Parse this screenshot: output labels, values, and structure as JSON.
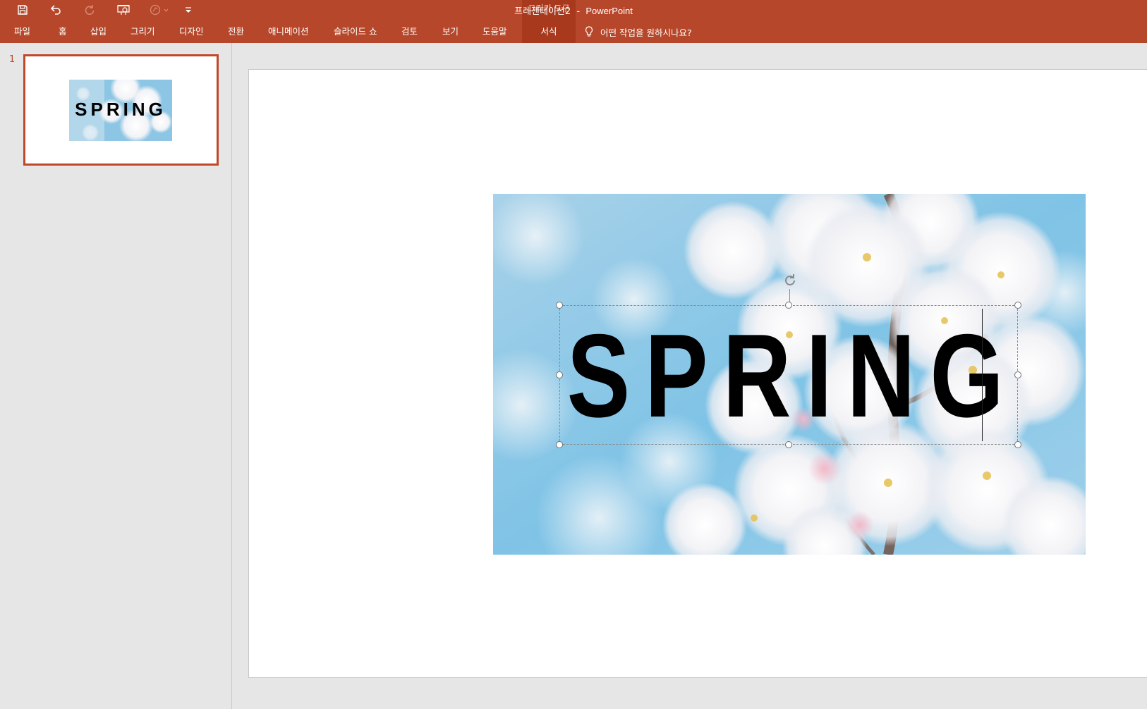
{
  "titlebar": {
    "document_title": "프레젠테이션2",
    "separator": "  -  ",
    "app_name": "PowerPoint",
    "contextual_group": "그리기 도구",
    "background_color": "#b7472a"
  },
  "quick_access": {
    "icons": [
      "save-icon",
      "undo-icon",
      "redo-icon",
      "start-slideshow-icon",
      "touch-mode-icon",
      "customize-qat-icon"
    ]
  },
  "ribbon": {
    "tabs": [
      {
        "label": "파일"
      },
      {
        "label": "홈"
      },
      {
        "label": "삽입"
      },
      {
        "label": "그리기"
      },
      {
        "label": "디자인"
      },
      {
        "label": "전환"
      },
      {
        "label": "애니메이션"
      },
      {
        "label": "슬라이드 쇼"
      },
      {
        "label": "검토"
      },
      {
        "label": "보기"
      },
      {
        "label": "도움말"
      },
      {
        "label": "서식"
      }
    ],
    "tell_me": "어떤 작업을 원하시나요?"
  },
  "thumbnails": [
    {
      "number": "1",
      "text": "SPRING",
      "selected": true
    }
  ],
  "slide": {
    "text": "SPRING",
    "image": "cherry-blossom-photo"
  }
}
